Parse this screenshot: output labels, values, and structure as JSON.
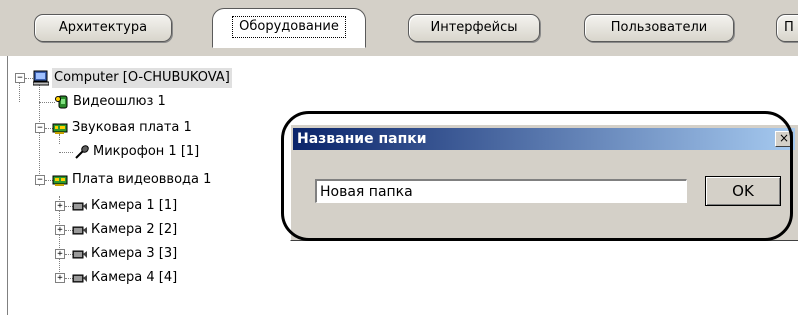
{
  "tabs": [
    {
      "label": "Архитектура",
      "active": false
    },
    {
      "label": "Оборудование",
      "active": true
    },
    {
      "label": "Интерфейсы",
      "active": false
    },
    {
      "label": "Пользователи",
      "active": false
    },
    {
      "label": "П",
      "active": false
    }
  ],
  "tree": {
    "root": "Computer [O-CHUBUKOVA]",
    "items": [
      {
        "label": "Видеошлюз 1",
        "icon": "video-gateway-icon"
      },
      {
        "label": "Звуковая плата 1",
        "icon": "sound-card-icon"
      },
      {
        "label": "Микрофон 1 [1]",
        "icon": "microphone-icon"
      },
      {
        "label": "Плата видеоввода 1",
        "icon": "video-capture-board-icon"
      },
      {
        "label": "Камера 1 [1]",
        "icon": "camera-icon"
      },
      {
        "label": "Камера 2 [2]",
        "icon": "camera-icon"
      },
      {
        "label": "Камера 3 [3]",
        "icon": "camera-icon"
      },
      {
        "label": "Камера 4 [4]",
        "icon": "camera-icon"
      }
    ]
  },
  "dialog": {
    "title": "Название папки",
    "close_glyph": "×",
    "input_value": "Новая папка",
    "ok_label": "OK"
  },
  "expander": {
    "minus": "−",
    "plus": "+"
  },
  "colors": {
    "title_bar_start": "#0a246a",
    "title_bar_end": "#a6caf0",
    "window_face": "#d4d0c8"
  }
}
